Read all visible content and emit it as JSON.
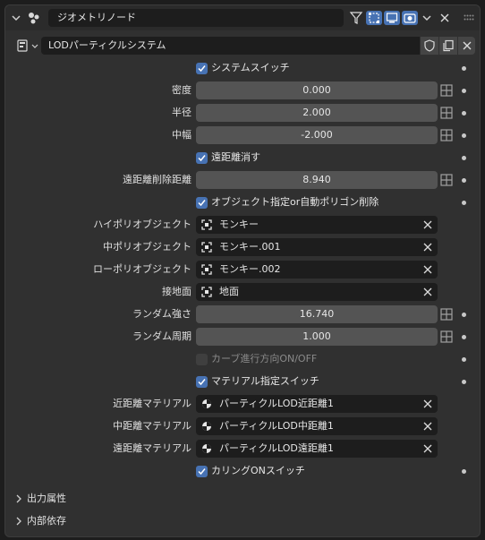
{
  "node": {
    "title": "ジオメトリノード"
  },
  "modifier": {
    "name": "LODパーティクルシステム"
  },
  "fields": {
    "system_switch": "システムスイッチ",
    "density_label": "密度",
    "density_value": "0.000",
    "radius_label": "半径",
    "radius_value": "2.000",
    "width_label": "中幅",
    "width_value": "-2.000",
    "far_erase": "遠距離消す",
    "far_erase_dist_label": "遠距離削除距離",
    "far_erase_dist_value": "8.940",
    "object_or_auto": "オブジェクト指定or自動ポリゴン削除",
    "hipoly_label": "ハイポリオブジェクト",
    "hipoly_value": "モンキー",
    "midpoly_label": "中ポリオブジェクト",
    "midpoly_value": "モンキー.001",
    "lowpoly_label": "ローポリオブジェクト",
    "lowpoly_value": "モンキー.002",
    "ground_label": "接地面",
    "ground_value": "地面",
    "random_strength_label": "ランダム強さ",
    "random_strength_value": "16.740",
    "random_period_label": "ランダム周期",
    "random_period_value": "1.000",
    "curve_dir": "カーブ進行方向ON/OFF",
    "material_switch": "マテリアル指定スイッチ",
    "near_mat_label": "近距離マテリアル",
    "near_mat_value": "パーティクルLOD近距離1",
    "mid_mat_label": "中距離マテリアル",
    "mid_mat_value": "パーティクルLOD中距離1",
    "far_mat_label": "遠距離マテリアル",
    "far_mat_value": "パーティクルLOD遠距離1",
    "culling": "カリングONスイッチ"
  },
  "sections": {
    "output": "出力属性",
    "internal": "内部依存"
  },
  "colors": {
    "accent": "#4772b3",
    "field": "#545454",
    "panel": "#303030"
  }
}
